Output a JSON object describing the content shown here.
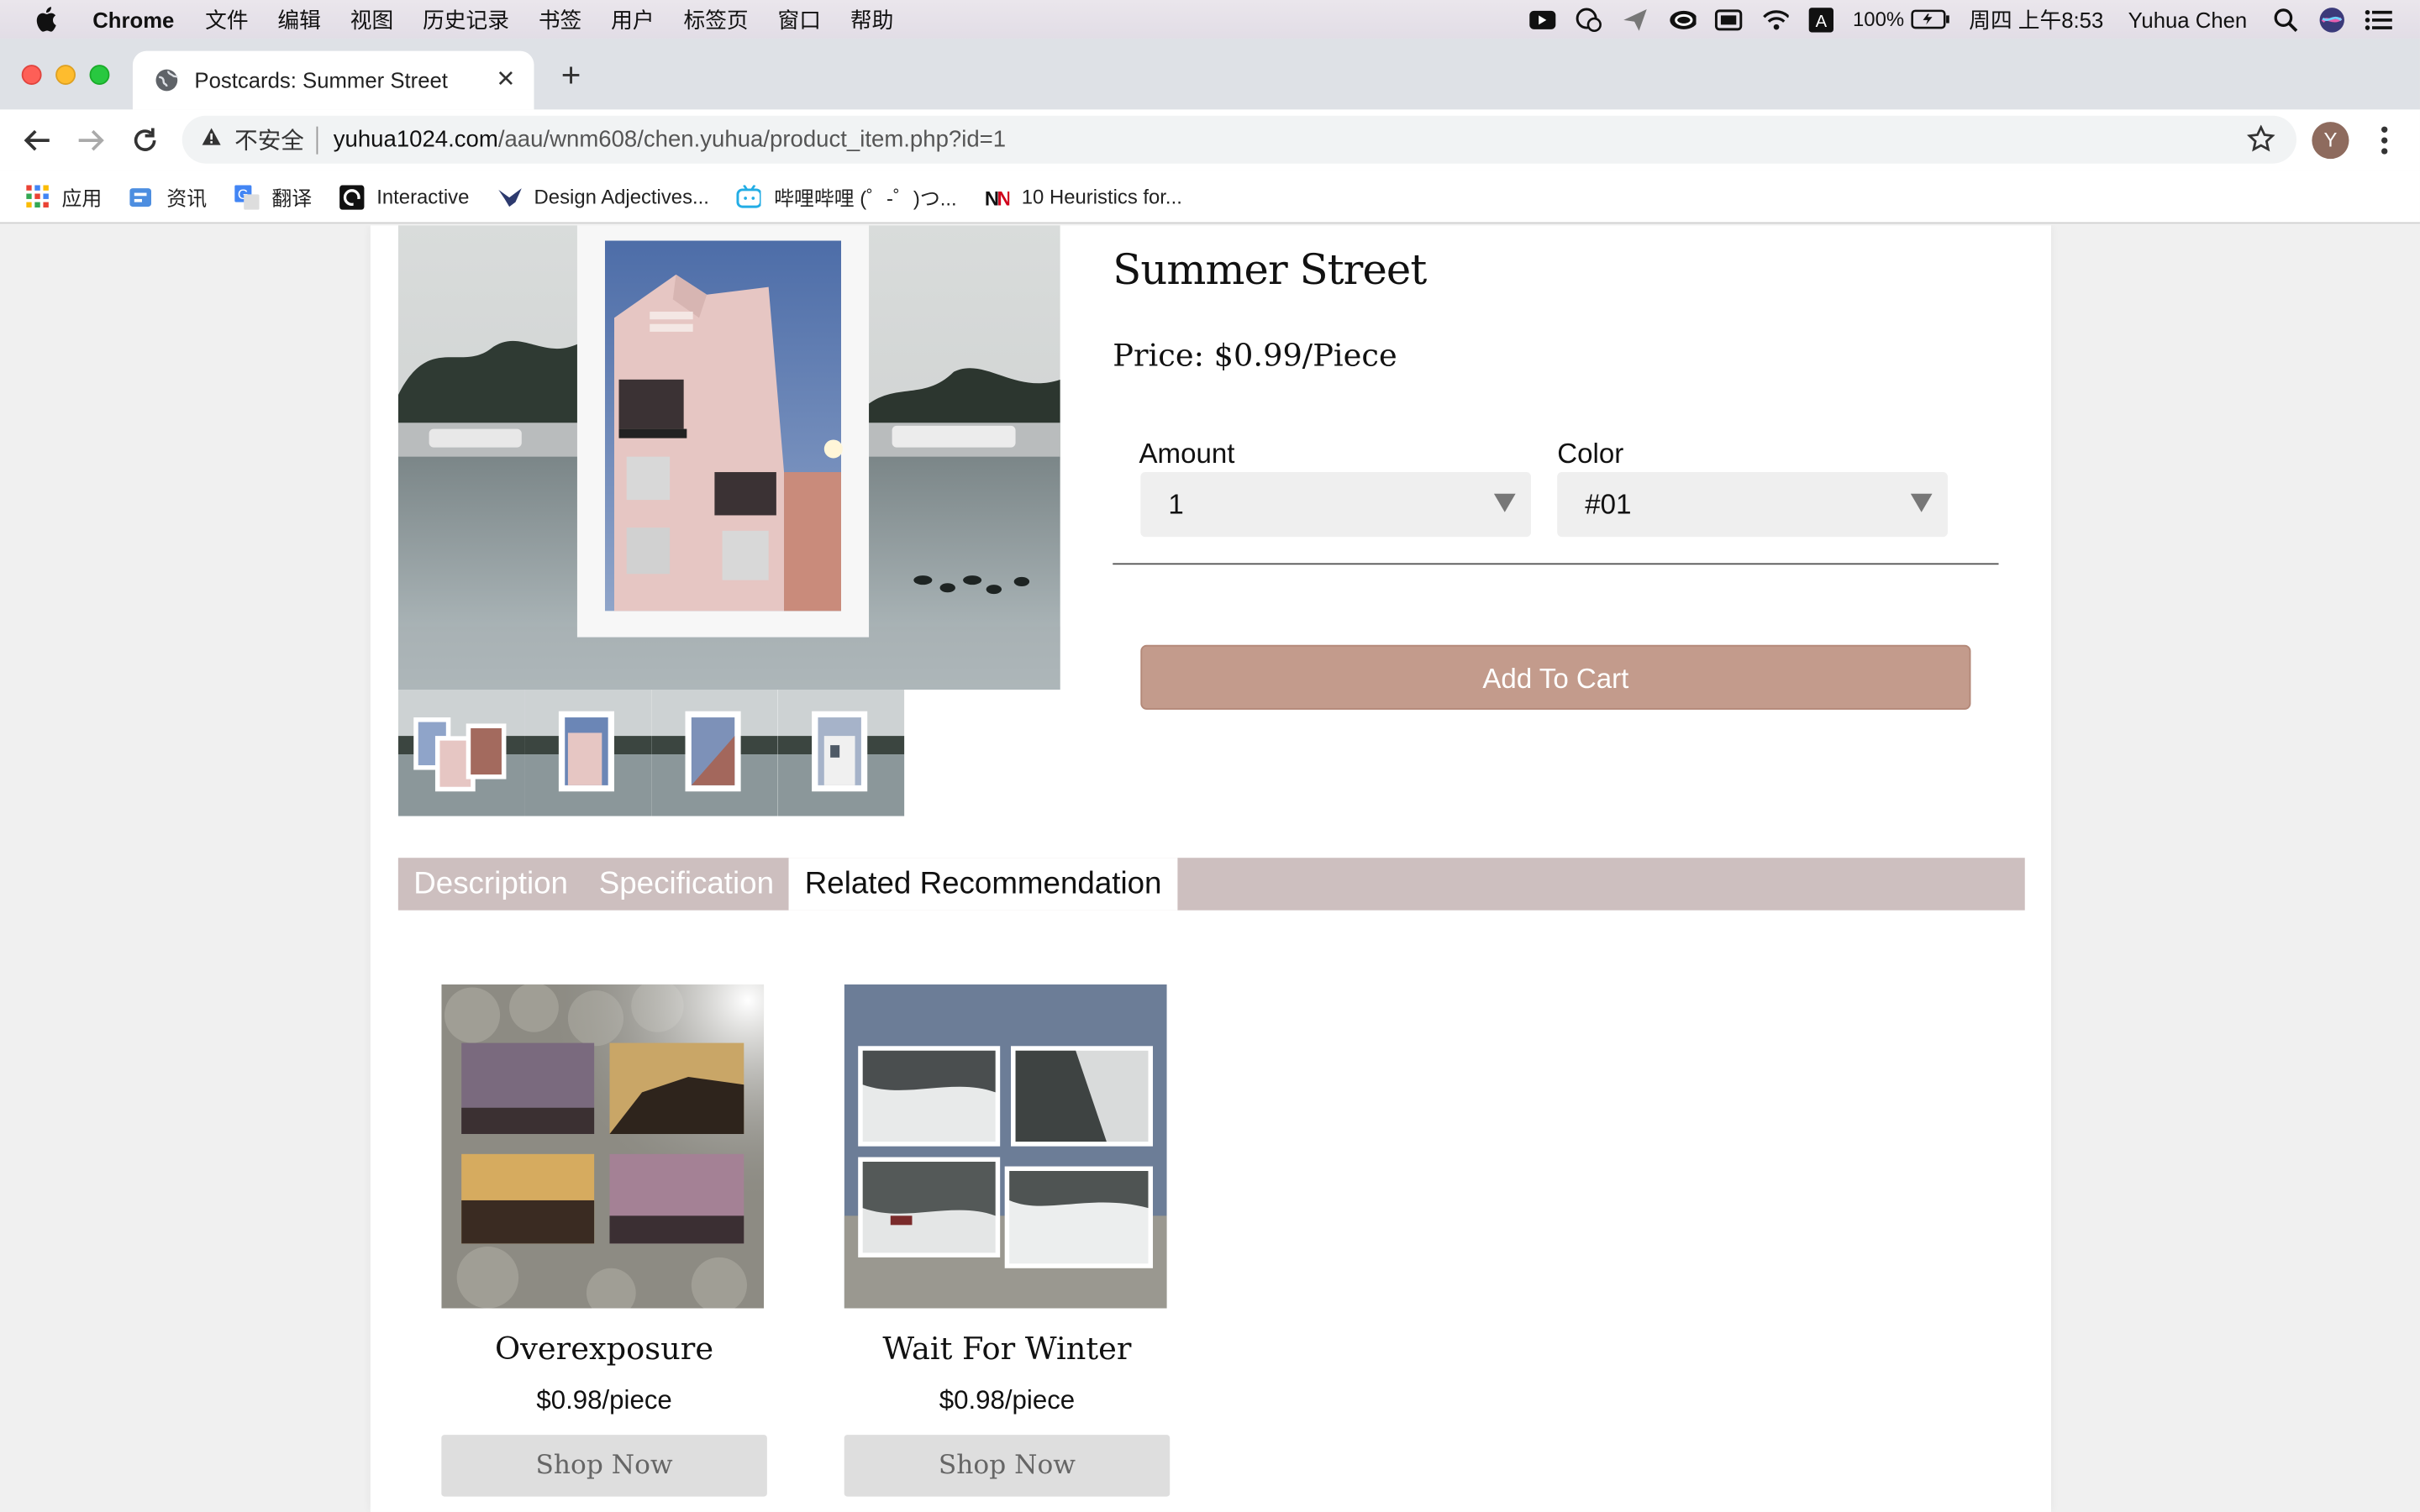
{
  "menubar": {
    "app": "Chrome",
    "items": [
      "文件",
      "编辑",
      "视图",
      "历史记录",
      "书签",
      "用户",
      "标签页",
      "窗口",
      "帮助"
    ],
    "battery": "100%",
    "datetime": "周四 上午8:53",
    "user": "Yuhua Chen"
  },
  "browser": {
    "tab_title": "Postcards: Summer Street",
    "insecure_label": "不安全",
    "url_host": "yuhua1024.com",
    "url_path": "/aau/wnm608/chen.yuhua/product_item.php?id=1",
    "avatar_letter": "Y",
    "bookmarks": [
      {
        "label": "应用",
        "icon": "apps-grid-icon"
      },
      {
        "label": "资讯",
        "icon": "news-icon"
      },
      {
        "label": "翻译",
        "icon": "translate-icon"
      },
      {
        "label": "Interactive",
        "icon": "interactive-icon"
      },
      {
        "label": "Design Adjectives...",
        "icon": "bird-icon"
      },
      {
        "label": "哔哩哔哩 (゜-゜)つ...",
        "icon": "bilibili-icon"
      },
      {
        "label": "10 Heuristics for...",
        "icon": "nn-icon"
      }
    ]
  },
  "product": {
    "title": "Summer Street",
    "price": "Price: $0.99/Piece",
    "amount_label": "Amount",
    "amount_value": "1",
    "color_label": "Color",
    "color_value": "#01",
    "add_to_cart": "Add To Cart"
  },
  "tabs": [
    {
      "label": "Description",
      "active": false
    },
    {
      "label": "Specification",
      "active": false
    },
    {
      "label": "Related Recommendation",
      "active": true
    }
  ],
  "related": [
    {
      "name": "Overexposure",
      "price": "$0.98/piece",
      "button": "Shop Now"
    },
    {
      "name": "Wait For Winter",
      "price": "$0.98/piece",
      "button": "Shop Now"
    }
  ],
  "colors": {
    "accent": "#c39b8c",
    "tabs_bg": "#cdbfbf",
    "page_bg": "#f0f0f0"
  }
}
